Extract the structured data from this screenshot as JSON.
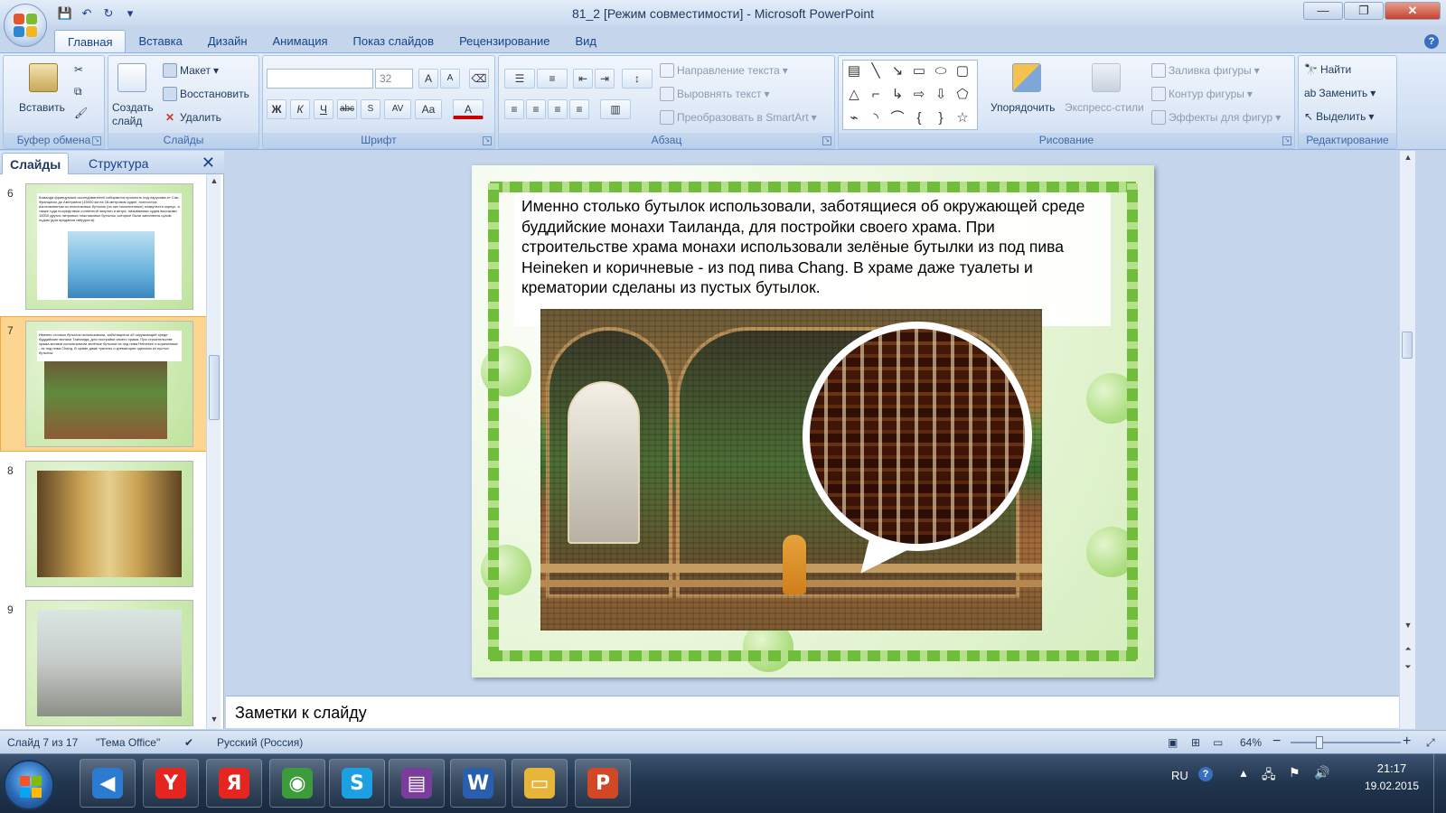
{
  "window": {
    "title": "81_2 [Режим совместимости] - Microsoft PowerPoint",
    "minimize": "—",
    "maximize": "❐",
    "close": "✕"
  },
  "qat": {
    "save": "💾",
    "undo": "↶",
    "redo": "↻",
    "more": "▾"
  },
  "tabs": [
    "Главная",
    "Вставка",
    "Дизайн",
    "Анимация",
    "Показ слайдов",
    "Рецензирование",
    "Вид"
  ],
  "ribbon": {
    "clipboard": {
      "paste": "Вставить",
      "label": "Буфер обмена"
    },
    "slides": {
      "new_slide": "Создать слайд",
      "layout": "Макет",
      "reset": "Восстановить",
      "delete": "Удалить",
      "label": "Слайды"
    },
    "font": {
      "font_name": "",
      "font_size": "32",
      "grow": "A",
      "shrink": "A",
      "bold": "Ж",
      "italic": "К",
      "underline": "Ч",
      "strike": "abc",
      "spacing": "AV",
      "case": "Aa",
      "color": "A",
      "label": "Шрифт"
    },
    "paragraph": {
      "text_direction": "Направление текста",
      "align_text": "Выровнять текст",
      "smartart": "Преобразовать в SmartArt",
      "label": "Абзац"
    },
    "drawing": {
      "arrange": "Упорядочить",
      "quick_styles": "Экспресс-стили",
      "fill": "Заливка фигуры",
      "outline": "Контур фигуры",
      "effects": "Эффекты для фигур",
      "label": "Рисование"
    },
    "editing": {
      "find": "Найти",
      "replace": "Заменить",
      "select": "Выделить",
      "label": "Редактирование"
    }
  },
  "panel": {
    "tab_slides": "Слайды",
    "tab_outline": "Структура",
    "close": "✕",
    "thumbnails": [
      {
        "num": "6",
        "text": "Команда французских исследователей собирается проплыть под парусами от Сан-Франциско до Австралии (15000 км на 18-метровом судне, полностью изготовленном из пластиковых бутылок (из них наполненные) плавучести корпус, а также туда посредством солнечной энергии и ветра, называемая судна высокими 15000 других литровых пластиковых бутылок, которые были заполнены сухим льдом (для придания твёрдости)."
      },
      {
        "num": "7",
        "text": "Именно столько бутылок использовали, заботящиеся об окружающей среде буддийские монахи Таиланда, для постройки своего храма. При строительстве храма монахи использовали зелёные бутылки из под пива Heineken и коричневые - из под пива Chang. В храме даже туалеты и крематории сделаны из пустых бутылок."
      },
      {
        "num": "8",
        "text": ""
      },
      {
        "num": "9",
        "text": ""
      }
    ]
  },
  "slide": {
    "body": "Именно столько бутылок использовали, заботящиеся об окружающей среде буддийские монахи Таиланда, для постройки своего храма. При строительстве храма монахи использовали зелёные бутылки из под пива Heineken и коричневые - из под пива Chang. В храме даже туалеты и крематории сделаны из пустых бутылок."
  },
  "notes": {
    "placeholder": "Заметки к слайду"
  },
  "status": {
    "slide_info": "Слайд 7 из 17",
    "theme": "\"Тема Office\"",
    "language": "Русский (Россия)",
    "zoom": "64%",
    "minus": "−",
    "plus": "+"
  },
  "taskbar": {
    "lang": "RU",
    "time": "21:17",
    "date": "19.02.2015",
    "apps": [
      {
        "name": "volume-app",
        "glyph": "◀",
        "color": "#2d7bd1"
      },
      {
        "name": "yandex-browser",
        "glyph": "Y",
        "color": "#e52620"
      },
      {
        "name": "yandex",
        "glyph": "Я",
        "color": "#e52620"
      },
      {
        "name": "chrome",
        "glyph": "◉",
        "color": "#3c9b3a"
      },
      {
        "name": "skype",
        "glyph": "S",
        "color": "#1ba0e2"
      },
      {
        "name": "winrar",
        "glyph": "▤",
        "color": "#7b3d9b"
      },
      {
        "name": "word",
        "glyph": "W",
        "color": "#2a5fb0"
      },
      {
        "name": "explorer",
        "glyph": "▭",
        "color": "#e6b53a"
      },
      {
        "name": "powerpoint",
        "glyph": "P",
        "color": "#d24726"
      }
    ]
  },
  "colors": {
    "accent": "#1e395b",
    "ribbon": "#d1e0f3",
    "selected_thumb": "#fcd690"
  }
}
